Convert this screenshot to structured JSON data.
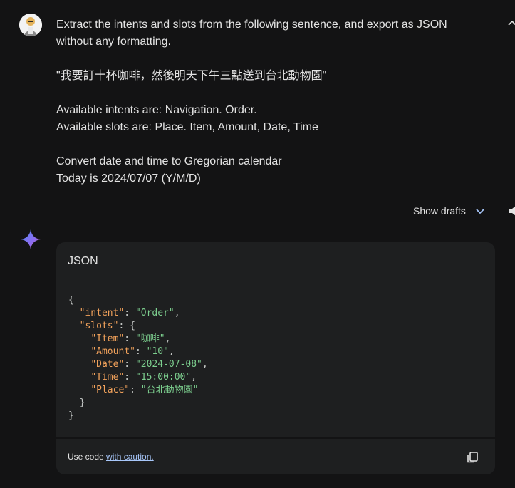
{
  "user": {
    "avatar_icon": "user-avatar",
    "prompt_lines": [
      "Extract the intents and slots from the following sentence, and export as JSON",
      "without any formatting.",
      "\"我要訂十杯咖啡，然後明天下午三點送到台北動物園\"",
      "Available intents are: Navigation. Order.",
      "Available slots are: Place. Item, Amount, Date, Time",
      "Convert date and time to Gregorian calendar",
      "Today is 2024/07/07 (Y/M/D)"
    ]
  },
  "drafts": {
    "label": "Show drafts",
    "icon": "chevron-down-icon"
  },
  "response": {
    "icon": "gemini-sparkle-icon",
    "code": {
      "language": "JSON",
      "json": {
        "intent": "Order",
        "Item": "咖啡",
        "Amount": "10",
        "Date": "2024-07-08",
        "Time": "15:00:00",
        "Place": "台北動物園"
      },
      "caution_prefix": "Use code ",
      "caution_link": "with caution.",
      "copy_icon": "copy-icon"
    }
  },
  "colors": {
    "background": "#131314",
    "card": "#1e1f20",
    "json_key": "#f2a25b",
    "json_string": "#7dcf8f",
    "link": "#a8c7fa"
  }
}
